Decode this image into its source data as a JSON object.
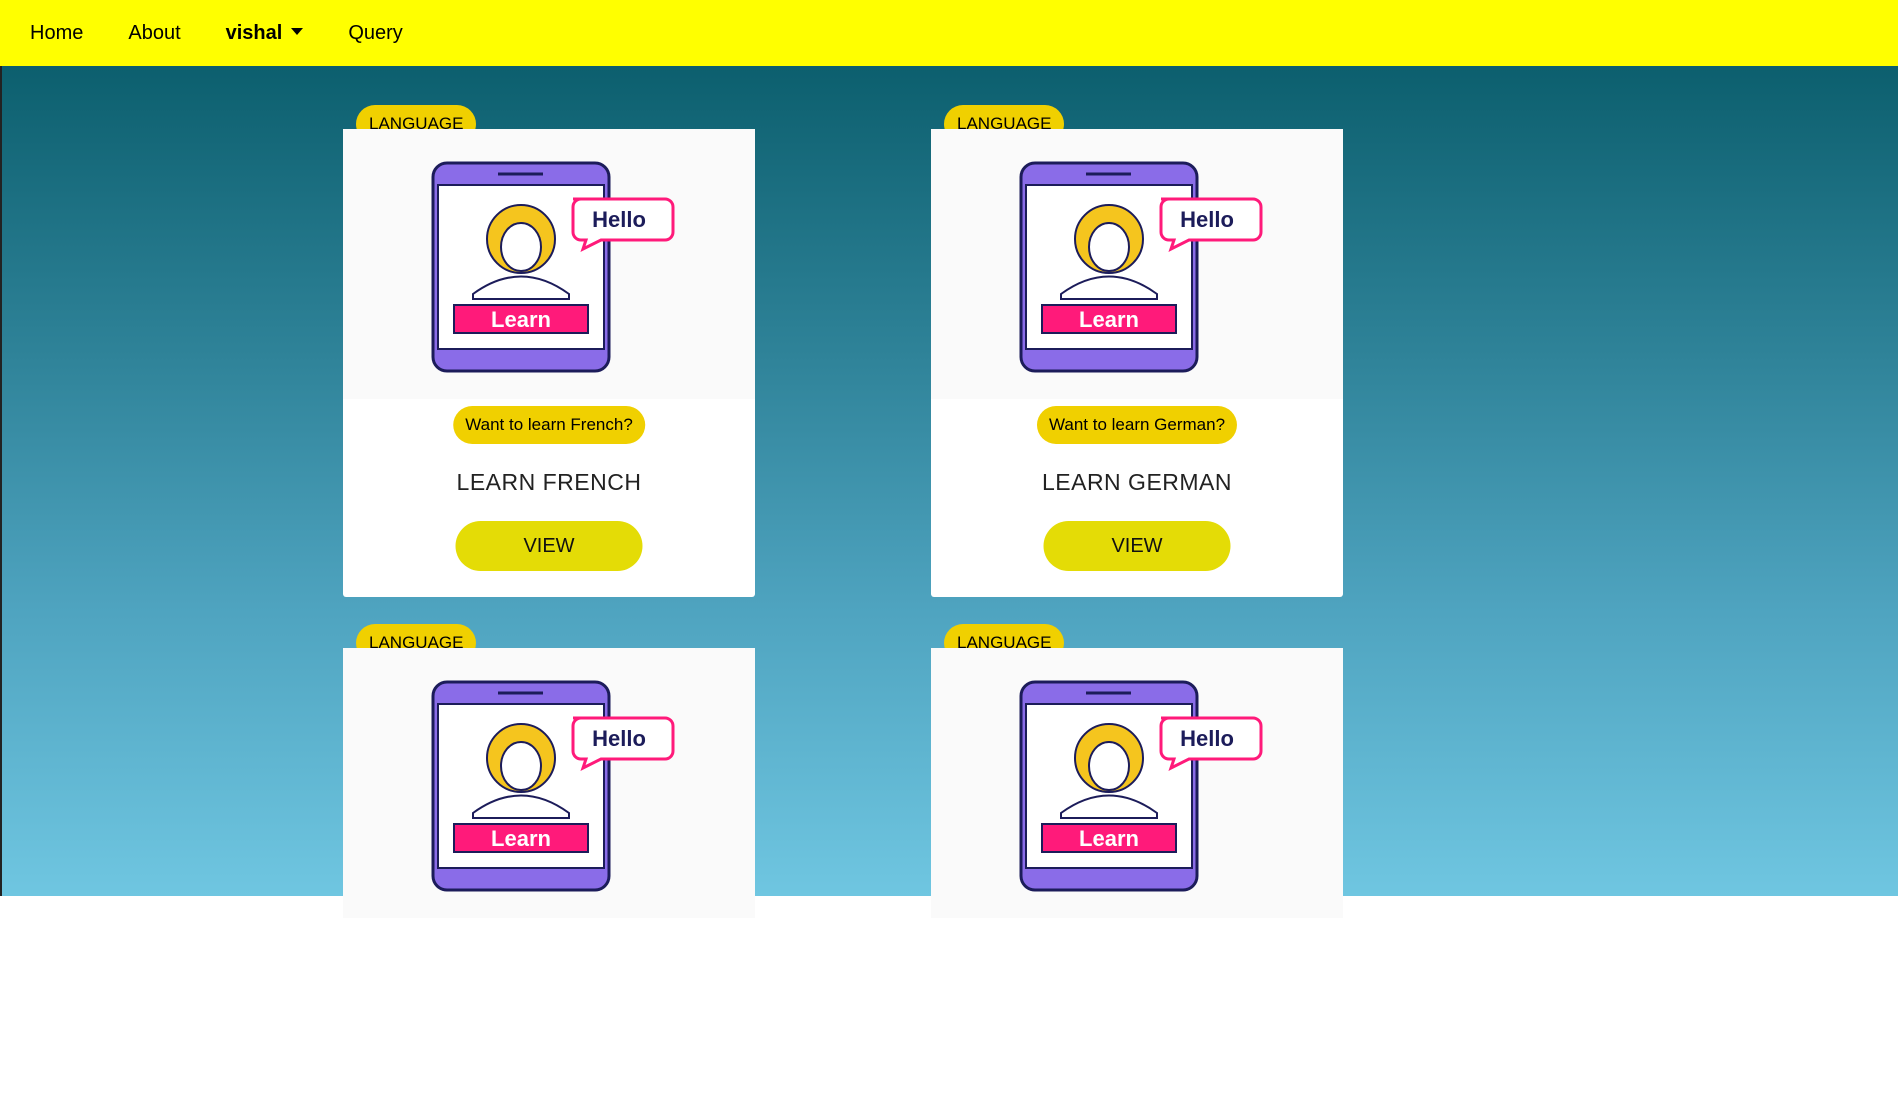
{
  "nav": {
    "home": "Home",
    "about": "About",
    "user": "vishal",
    "query": "Query"
  },
  "illustration": {
    "bubble_text": "Hello",
    "banner_text": "Learn"
  },
  "cards": [
    {
      "badge": "LANGUAGE",
      "question": "Want to learn French?",
      "title": "LEARN FRENCH",
      "button": "VIEW"
    },
    {
      "badge": "LANGUAGE",
      "question": "Want to learn German?",
      "title": "LEARN GERMAN",
      "button": "VIEW"
    },
    {
      "badge": "LANGUAGE"
    },
    {
      "badge": "LANGUAGE"
    }
  ],
  "colors": {
    "navbar": "#ffff00",
    "badge": "#f0d000",
    "button": "#e4dc06",
    "phone": "#8a6ce8",
    "learn_banner": "#ff1a7a"
  }
}
